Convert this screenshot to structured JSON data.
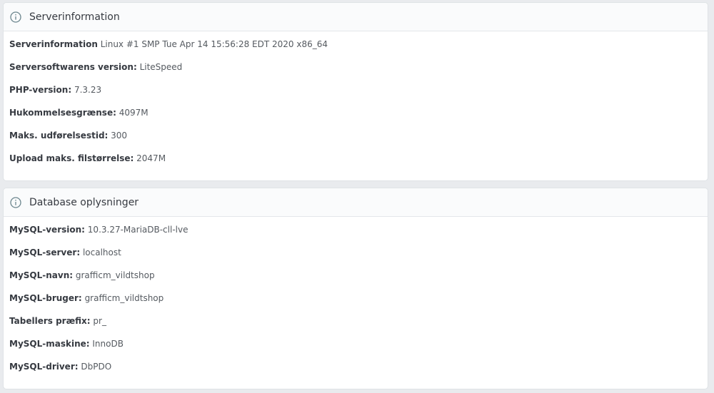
{
  "server_panel": {
    "title": "Serverinformation",
    "icon": "info-icon",
    "rows": [
      {
        "label": "Serverinformation",
        "value": "Linux #1 SMP Tue Apr 14 15:56:28 EDT 2020 x86_64"
      },
      {
        "label": "Serversoftwarens version:",
        "value": "LiteSpeed"
      },
      {
        "label": "PHP-version:",
        "value": "7.3.23"
      },
      {
        "label": "Hukommelsesgrænse:",
        "value": "4097M"
      },
      {
        "label": "Maks. udførelsestid:",
        "value": "300"
      },
      {
        "label": "Upload maks. filstørrelse:",
        "value": "2047M"
      }
    ]
  },
  "db_panel": {
    "title": "Database oplysninger",
    "icon": "info-icon",
    "rows": [
      {
        "label": "MySQL-version:",
        "value": "10.3.27-MariaDB-cll-lve"
      },
      {
        "label": "MySQL-server:",
        "value": "localhost"
      },
      {
        "label": "MySQL-navn:",
        "value": "grafficm_vildtshop"
      },
      {
        "label": "MySQL-bruger:",
        "value": "grafficm_vildtshop"
      },
      {
        "label": "Tabellers præfix:",
        "value": "pr_"
      },
      {
        "label": "MySQL-maskine:",
        "value": "InnoDB"
      },
      {
        "label": "MySQL-driver:",
        "value": "DbPDO"
      }
    ]
  },
  "colors": {
    "background": "#e9ebee",
    "panel": "#ffffff",
    "header": "#fafbfc",
    "text": "#363a41",
    "icon": "#6c868e"
  }
}
